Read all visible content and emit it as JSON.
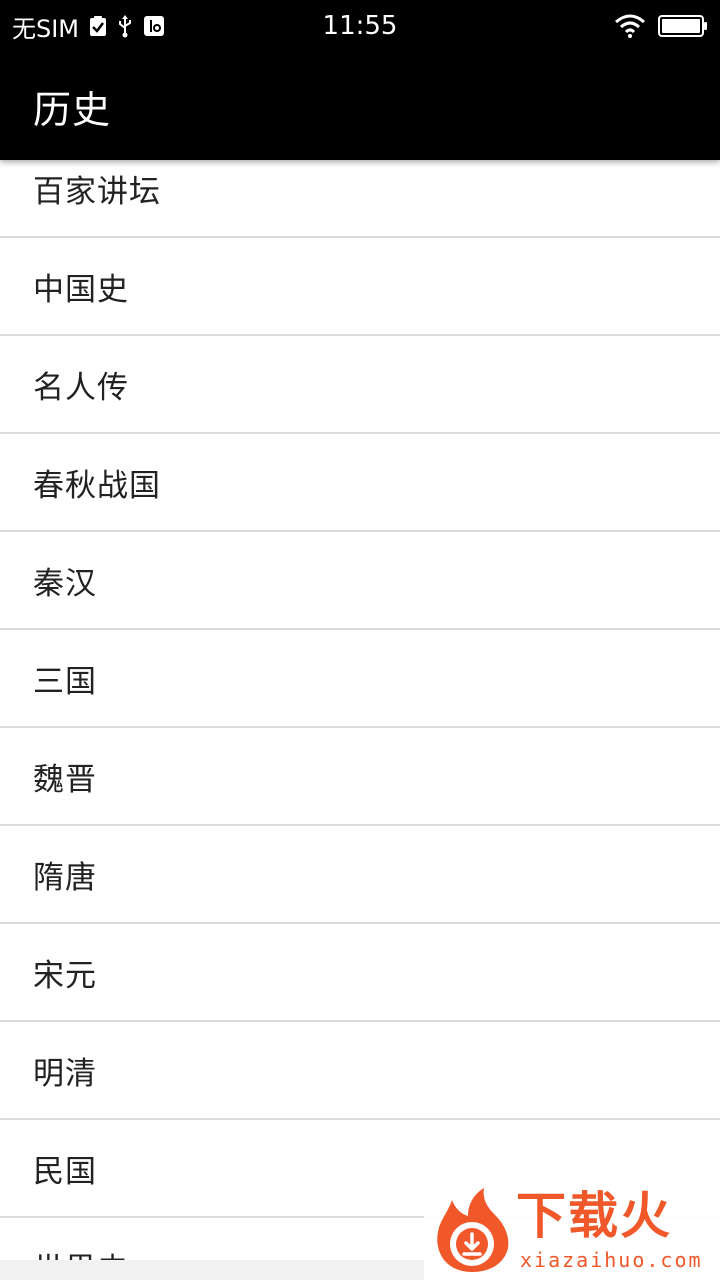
{
  "status_bar": {
    "carrier": "无SIM",
    "time": "11:55",
    "icons": [
      "check-notification-icon",
      "usb-icon",
      "usb-debug-icon",
      "wifi-icon",
      "battery-icon"
    ]
  },
  "app_bar": {
    "title": "历史"
  },
  "list": {
    "items": [
      {
        "label": "百家讲坛"
      },
      {
        "label": "中国史"
      },
      {
        "label": "名人传"
      },
      {
        "label": "春秋战国"
      },
      {
        "label": "秦汉"
      },
      {
        "label": "三国"
      },
      {
        "label": "魏晋"
      },
      {
        "label": "隋唐"
      },
      {
        "label": "宋元"
      },
      {
        "label": "明清"
      },
      {
        "label": "民国"
      },
      {
        "label": "世界史"
      }
    ]
  },
  "watermark": {
    "name": "下载火",
    "domain": "xiazaihuo.com",
    "color": "#f0582a"
  }
}
